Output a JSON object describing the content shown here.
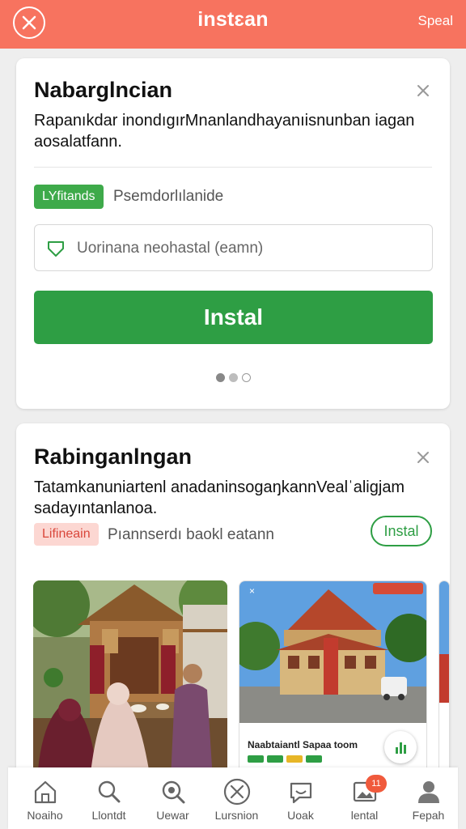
{
  "topbar": {
    "title": "instɛan",
    "right_link": "Speal"
  },
  "card1": {
    "title": "Nabarglncian",
    "description": "Rapanıkdar inondıgırMnanlandhayanıisnunban iagan aosalatfann.",
    "badge": "LYfitands",
    "badge_caption": "Psemdorlılanide",
    "input_placeholder": "Uorinana neohastal (eamn)",
    "install_label": "Instal",
    "pager_dots": 3,
    "active_dot": 0
  },
  "card2": {
    "title": "Rabinganlngan",
    "description": "Tatamkanuniartenl anadaninsogaŋkannVealˈaligjam sadayıntanlanoa.",
    "badge": "Lifineain",
    "badge_caption": "Pıannserdı baokl eatann",
    "install_label": "Instal",
    "photo2_caption": "Naabtaiantl Sapaa toom"
  },
  "bottom_nav": [
    {
      "label": "Noaiho",
      "icon": "home-icon"
    },
    {
      "label": "Llontdt",
      "icon": "search-icon"
    },
    {
      "label": "Uewar",
      "icon": "search-zoom-icon"
    },
    {
      "label": "Lursnion",
      "icon": "cancel-circle-icon"
    },
    {
      "label": "Uoak",
      "icon": "chat-icon"
    },
    {
      "label": "lental",
      "icon": "gallery-icon",
      "badge": "11"
    },
    {
      "label": "Fepah",
      "icon": "profile-icon"
    }
  ],
  "colors": {
    "topbar": "#f7735f",
    "primary_green": "#2e9e44",
    "badge_red_bg": "#fcd7d2"
  }
}
